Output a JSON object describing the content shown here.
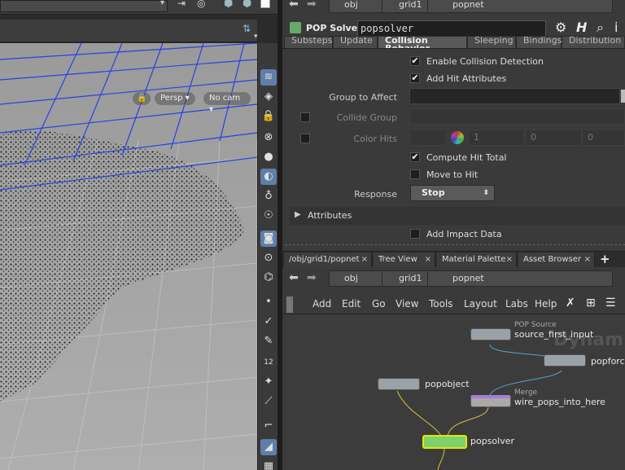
{
  "viewport": {
    "camera_label": "Persp",
    "cam_label": "No cam",
    "sidebar_icons": [
      "display-options-icon",
      "hide-icon",
      "lock-icon",
      "ghost-icon",
      "shading-icon",
      "light-icon",
      "bulb-icon",
      "headlight-icon",
      "camera-icon",
      "snapshot-icon",
      "flipbook-icon",
      "point-display-icon",
      "brush-icon",
      "pen-icon",
      "number-display-icon",
      "paint-icon",
      "normal-icon",
      "bounds-icon",
      "texture-icon",
      "checker-icon"
    ],
    "number_icon_text": "12"
  },
  "param_pane": {
    "path": {
      "obj": "obj",
      "grid": "grid1",
      "node": "popnet"
    },
    "node_type": "POP Solver",
    "node_name": "popsolver",
    "tabs": [
      "Substeps",
      "Update",
      "Collision Behavior",
      "Sleeping",
      "Bindings",
      "Distribution"
    ],
    "params": {
      "enable_collision": "Enable Collision Detection",
      "add_hit_attribs": "Add Hit Attributes",
      "group_to_affect": "Group to Affect",
      "collide_group": "Collide Group",
      "color_hits": "Color Hits",
      "color_values": [
        "1",
        "0",
        "0"
      ],
      "compute_hit_total": "Compute Hit Total",
      "move_to_hit": "Move to Hit",
      "response_label": "Response",
      "response_value": "Stop",
      "attributes_folder": "Attributes",
      "add_impact_data": "Add Impact Data"
    }
  },
  "network": {
    "tabs": [
      "/obj/grid1/popnet",
      "Tree View",
      "Material Palette",
      "Asset Browser"
    ],
    "path": {
      "obj": "obj",
      "grid": "grid1",
      "node": "popnet"
    },
    "menus": [
      "Add",
      "Edit",
      "Go",
      "View",
      "Tools",
      "Layout",
      "Labs",
      "Help"
    ],
    "watermark": "Dynam",
    "nodes": {
      "source_type": "POP Source",
      "source_name": "source_first_input",
      "popforce": "popforce",
      "popobject": "popobject",
      "merge_type": "Merge",
      "merge_name": "wire_pops_into_here",
      "popsolver": "popsolver"
    }
  }
}
